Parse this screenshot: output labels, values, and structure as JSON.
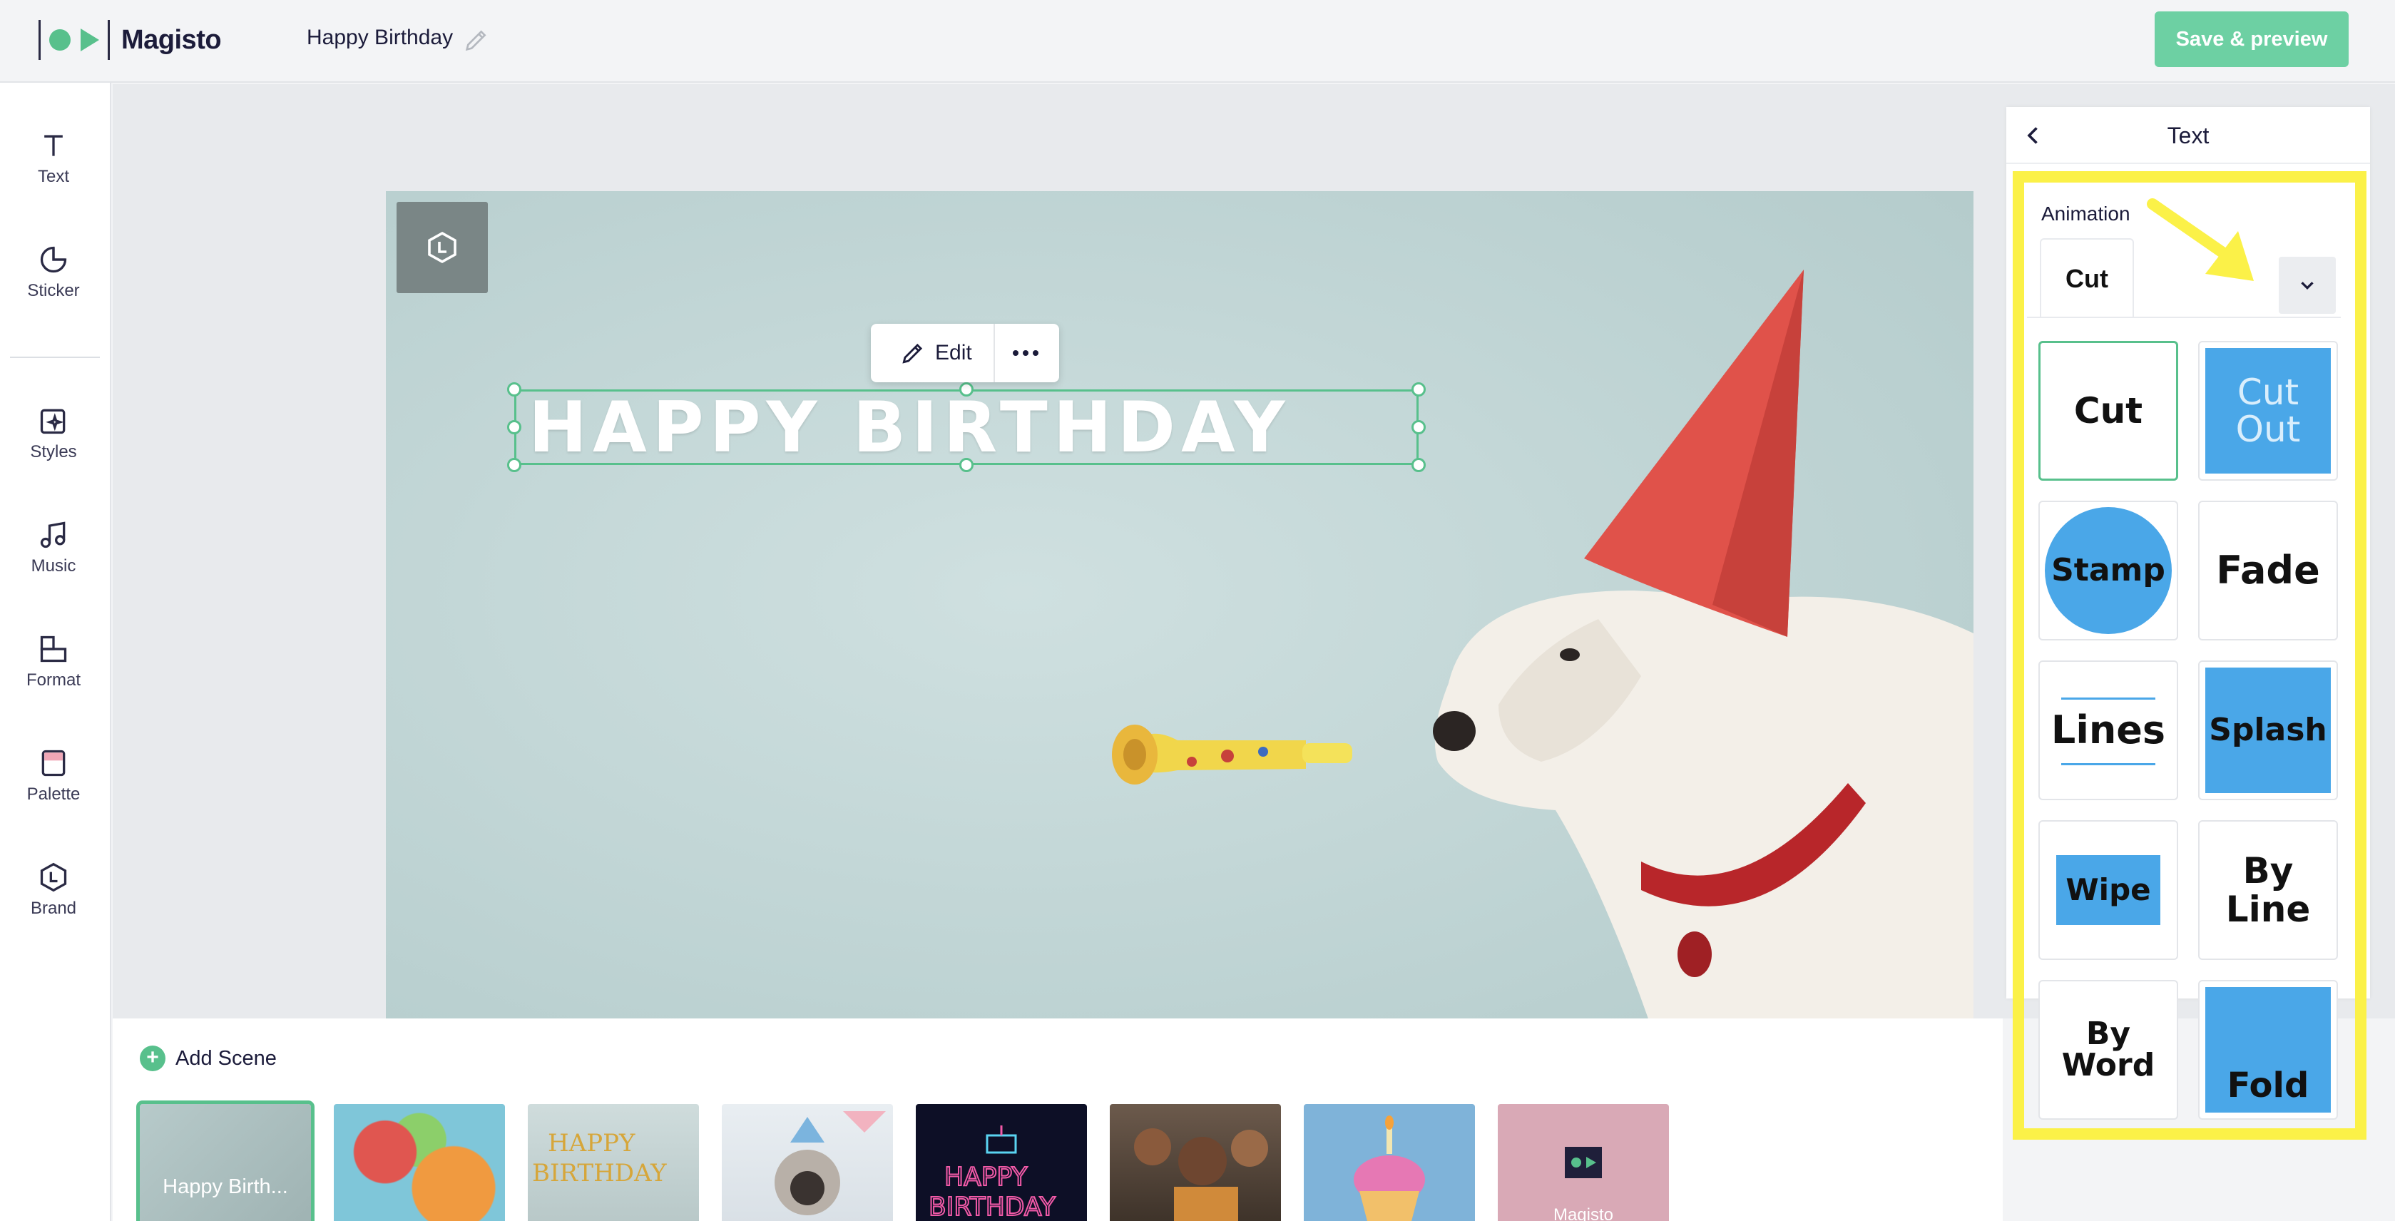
{
  "app": {
    "name": "Magisto",
    "project_title": "Happy Birthday",
    "save_label": "Save & preview"
  },
  "sidebar": {
    "items": [
      {
        "label": "Text",
        "icon": "text-icon"
      },
      {
        "label": "Sticker",
        "icon": "sticker-icon"
      },
      {
        "label": "Styles",
        "icon": "styles-icon"
      },
      {
        "label": "Music",
        "icon": "music-icon"
      },
      {
        "label": "Format",
        "icon": "format-icon"
      },
      {
        "label": "Palette",
        "icon": "palette-icon"
      },
      {
        "label": "Brand",
        "icon": "brand-icon"
      }
    ]
  },
  "canvas": {
    "headline": "HAPPY BIRTHDAY",
    "edit_label": "Edit"
  },
  "panel": {
    "title": "Text",
    "animation_label": "Animation",
    "selected_animation": "Cut",
    "options": [
      {
        "label": "Cut",
        "selected": true
      },
      {
        "label": "Cut Out"
      },
      {
        "label": "Stamp"
      },
      {
        "label": "Fade"
      },
      {
        "label": "Lines"
      },
      {
        "label": "Splash"
      },
      {
        "label": "Wipe"
      },
      {
        "label": "By Line"
      },
      {
        "label": "By Word"
      },
      {
        "label": "Fold"
      }
    ]
  },
  "scenes": {
    "add_label": "Add Scene",
    "thumbnails": [
      {
        "caption": "Happy Birth...",
        "selected": true
      },
      {
        "caption": ""
      },
      {
        "caption": ""
      },
      {
        "caption": ""
      },
      {
        "caption": ""
      },
      {
        "caption": ""
      },
      {
        "caption": ""
      },
      {
        "caption": "Magisto"
      }
    ]
  },
  "colors": {
    "accent": "#58c08c",
    "save_button": "#6dd0a3",
    "highlight": "#fbf148",
    "tile_blue": "#4aa7e8"
  }
}
